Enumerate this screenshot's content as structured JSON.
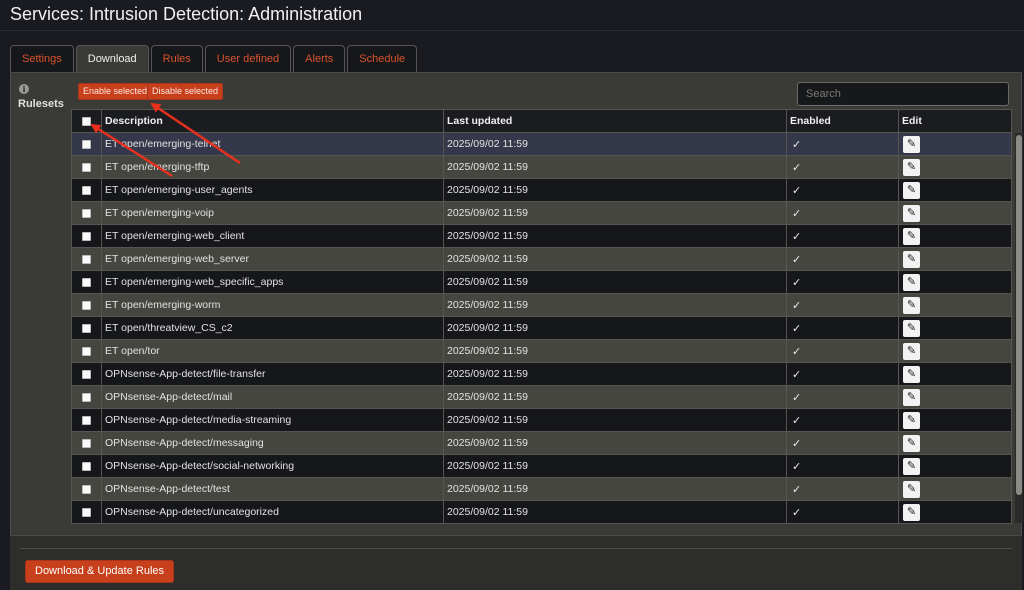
{
  "page": {
    "title": "Services: Intrusion Detection: Administration"
  },
  "tabs": [
    {
      "label": "Settings",
      "active": false
    },
    {
      "label": "Download",
      "active": true
    },
    {
      "label": "Rules",
      "active": false
    },
    {
      "label": "User defined",
      "active": false
    },
    {
      "label": "Alerts",
      "active": false
    },
    {
      "label": "Schedule",
      "active": false
    }
  ],
  "side": {
    "info_icon": "i",
    "label": "Rulesets"
  },
  "toolbar": {
    "enable_label": "Enable selected",
    "disable_label": "Disable selected",
    "search_placeholder": "Search"
  },
  "table": {
    "columns": [
      "Description",
      "Last updated",
      "Enabled",
      "Edit"
    ],
    "check_glyph": "✓",
    "edit_glyph": "✎",
    "rows": [
      {
        "description": "ET open/emerging-telnet",
        "updated": "2025/09/02 11:59",
        "enabled": true
      },
      {
        "description": "ET open/emerging-tftp",
        "updated": "2025/09/02 11:59",
        "enabled": true
      },
      {
        "description": "ET open/emerging-user_agents",
        "updated": "2025/09/02 11:59",
        "enabled": true
      },
      {
        "description": "ET open/emerging-voip",
        "updated": "2025/09/02 11:59",
        "enabled": true
      },
      {
        "description": "ET open/emerging-web_client",
        "updated": "2025/09/02 11:59",
        "enabled": true
      },
      {
        "description": "ET open/emerging-web_server",
        "updated": "2025/09/02 11:59",
        "enabled": true
      },
      {
        "description": "ET open/emerging-web_specific_apps",
        "updated": "2025/09/02 11:59",
        "enabled": true
      },
      {
        "description": "ET open/emerging-worm",
        "updated": "2025/09/02 11:59",
        "enabled": true
      },
      {
        "description": "ET open/threatview_CS_c2",
        "updated": "2025/09/02 11:59",
        "enabled": true
      },
      {
        "description": "ET open/tor",
        "updated": "2025/09/02 11:59",
        "enabled": true
      },
      {
        "description": "OPNsense-App-detect/file-transfer",
        "updated": "2025/09/02 11:59",
        "enabled": true
      },
      {
        "description": "OPNsense-App-detect/mail",
        "updated": "2025/09/02 11:59",
        "enabled": true
      },
      {
        "description": "OPNsense-App-detect/media-streaming",
        "updated": "2025/09/02 11:59",
        "enabled": true
      },
      {
        "description": "OPNsense-App-detect/messaging",
        "updated": "2025/09/02 11:59",
        "enabled": true
      },
      {
        "description": "OPNsense-App-detect/social-networking",
        "updated": "2025/09/02 11:59",
        "enabled": true
      },
      {
        "description": "OPNsense-App-detect/test",
        "updated": "2025/09/02 11:59",
        "enabled": true
      },
      {
        "description": "OPNsense-App-detect/uncategorized",
        "updated": "2025/09/02 11:59",
        "enabled": true
      }
    ]
  },
  "footer": {
    "button_label": "Download & Update Rules"
  },
  "colors": {
    "accent": "#c73f1b",
    "tab_text": "#d9532b",
    "annotation_arrow": "#e8301e"
  }
}
